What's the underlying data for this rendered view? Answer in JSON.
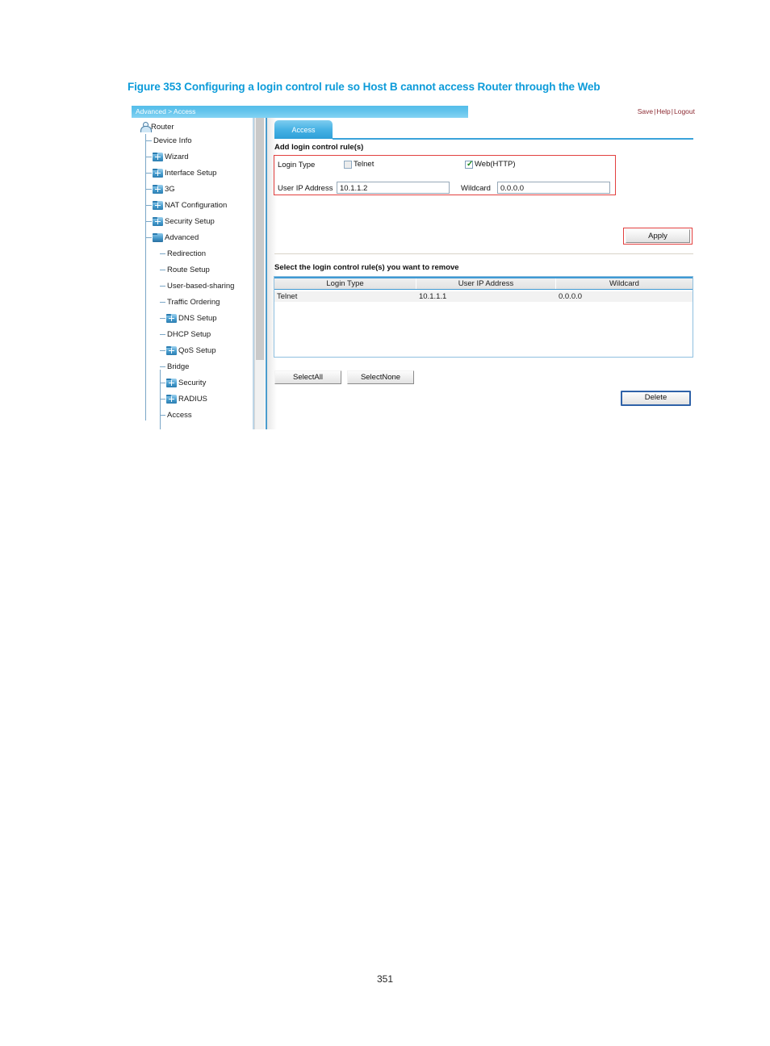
{
  "figure": {
    "caption": "Figure 353 Configuring a login control rule so Host B cannot access Router through the Web",
    "caption_color": "#0c9bd9"
  },
  "page": {
    "number": "351"
  },
  "header": {
    "breadcrumb": "Advanced > Access",
    "links": {
      "save": "Save",
      "help": "Help",
      "logout": "Logout",
      "separator": "|"
    },
    "bar_color": "#63c4ec",
    "link_color": "#8d2b33"
  },
  "sidebar": {
    "root": {
      "label": "Router",
      "icon": "user-icon"
    },
    "items": [
      {
        "label": "Device Info",
        "icon": "none",
        "level": 1
      },
      {
        "label": "Wizard",
        "icon": "folder-plus-icon",
        "level": 1
      },
      {
        "label": "Interface Setup",
        "icon": "folder-plus-icon",
        "level": 1
      },
      {
        "label": "3G",
        "icon": "folder-plus-icon",
        "level": 1
      },
      {
        "label": "NAT Configuration",
        "icon": "folder-plus-icon",
        "level": 1
      },
      {
        "label": "Security Setup",
        "icon": "folder-plus-icon",
        "level": 1
      },
      {
        "label": "Advanced",
        "icon": "folder-open-icon",
        "level": 1
      },
      {
        "label": "Redirection",
        "icon": "none",
        "level": 2
      },
      {
        "label": "Route Setup",
        "icon": "none",
        "level": 2
      },
      {
        "label": "User-based-sharing",
        "icon": "none",
        "level": 2
      },
      {
        "label": "Traffic Ordering",
        "icon": "none",
        "level": 2
      },
      {
        "label": "DNS Setup",
        "icon": "folder-plus-icon",
        "level": 2
      },
      {
        "label": "DHCP Setup",
        "icon": "none",
        "level": 2
      },
      {
        "label": "QoS Setup",
        "icon": "folder-plus-icon",
        "level": 2
      },
      {
        "label": "Bridge",
        "icon": "none",
        "level": 2
      },
      {
        "label": "Security",
        "icon": "folder-plus-icon",
        "level": 2
      },
      {
        "label": "RADIUS",
        "icon": "folder-plus-icon",
        "level": 2
      },
      {
        "label": "Access",
        "icon": "none",
        "level": 2
      }
    ]
  },
  "main": {
    "tab": {
      "label": "Access",
      "active": true
    },
    "add_section": {
      "title": "Add login control rule(s)",
      "login_type_label": "Login Type",
      "telnet": {
        "label": "Telnet",
        "checked": false
      },
      "web": {
        "label": "Web(HTTP)",
        "checked": true
      },
      "user_ip_label": "User IP Address",
      "user_ip_value": "10.1.1.2",
      "wildcard_label": "Wildcard",
      "wildcard_value": "0.0.0.0",
      "apply_label": "Apply",
      "highlight_color": "#e2403f"
    },
    "remove_section": {
      "title": "Select the login control rule(s) you want to remove",
      "columns": [
        "Login Type",
        "User IP Address",
        "Wildcard"
      ],
      "rows": [
        {
          "login_type": "Telnet",
          "user_ip": "10.1.1.1",
          "wildcard": "0.0.0.0"
        }
      ],
      "select_all_label": "SelectAll",
      "select_none_label": "SelectNone",
      "delete_label": "Delete"
    }
  }
}
